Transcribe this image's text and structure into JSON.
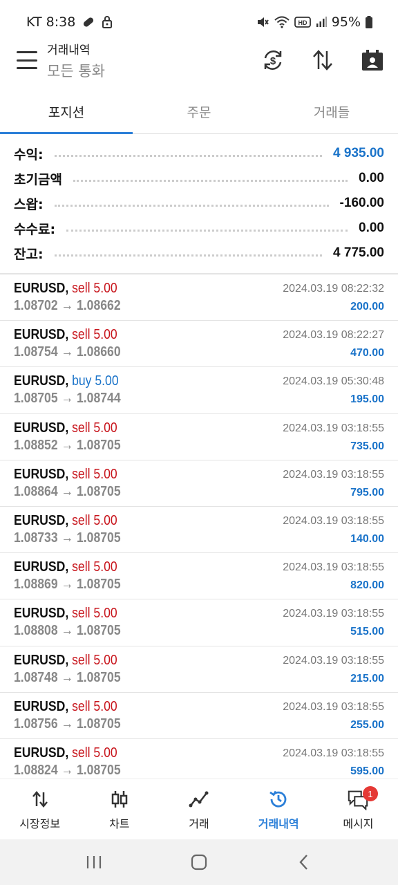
{
  "status_bar": {
    "carrier_time": "KT 8:38",
    "battery": "95%"
  },
  "header": {
    "title": "거래내역",
    "subtitle": "모든 통화"
  },
  "tabs": [
    {
      "label": "포지션",
      "active": true
    },
    {
      "label": "주문",
      "active": false
    },
    {
      "label": "거래들",
      "active": false
    }
  ],
  "summary": [
    {
      "label": "수익:",
      "value": "4 935.00"
    },
    {
      "label": "초기금액",
      "value": "0.00"
    },
    {
      "label": "스왑:",
      "value": "-160.00"
    },
    {
      "label": "수수료:",
      "value": "0.00"
    },
    {
      "label": "잔고:",
      "value": "4 775.00"
    }
  ],
  "deals": [
    {
      "symbol": "EURUSD,",
      "type": "sell 5.00",
      "side": "sell",
      "prices": "1.08702 → 1.08662",
      "time": "2024.03.19 08:22:32",
      "profit": "200.00"
    },
    {
      "symbol": "EURUSD,",
      "type": "sell 5.00",
      "side": "sell",
      "prices": "1.08754 → 1.08660",
      "time": "2024.03.19 08:22:27",
      "profit": "470.00"
    },
    {
      "symbol": "EURUSD,",
      "type": "buy 5.00",
      "side": "buy",
      "prices": "1.08705 → 1.08744",
      "time": "2024.03.19 05:30:48",
      "profit": "195.00"
    },
    {
      "symbol": "EURUSD,",
      "type": "sell 5.00",
      "side": "sell",
      "prices": "1.08852 → 1.08705",
      "time": "2024.03.19 03:18:55",
      "profit": "735.00"
    },
    {
      "symbol": "EURUSD,",
      "type": "sell 5.00",
      "side": "sell",
      "prices": "1.08864 → 1.08705",
      "time": "2024.03.19 03:18:55",
      "profit": "795.00"
    },
    {
      "symbol": "EURUSD,",
      "type": "sell 5.00",
      "side": "sell",
      "prices": "1.08733 → 1.08705",
      "time": "2024.03.19 03:18:55",
      "profit": "140.00"
    },
    {
      "symbol": "EURUSD,",
      "type": "sell 5.00",
      "side": "sell",
      "prices": "1.08869 → 1.08705",
      "time": "2024.03.19 03:18:55",
      "profit": "820.00"
    },
    {
      "symbol": "EURUSD,",
      "type": "sell 5.00",
      "side": "sell",
      "prices": "1.08808 → 1.08705",
      "time": "2024.03.19 03:18:55",
      "profit": "515.00"
    },
    {
      "symbol": "EURUSD,",
      "type": "sell 5.00",
      "side": "sell",
      "prices": "1.08748 → 1.08705",
      "time": "2024.03.19 03:18:55",
      "profit": "215.00"
    },
    {
      "symbol": "EURUSD,",
      "type": "sell 5.00",
      "side": "sell",
      "prices": "1.08756 → 1.08705",
      "time": "2024.03.19 03:18:55",
      "profit": "255.00"
    },
    {
      "symbol": "EURUSD,",
      "type": "sell 5.00",
      "side": "sell",
      "prices": "1.08824 → 1.08705",
      "time": "2024.03.19 03:18:55",
      "profit": "595.00"
    }
  ],
  "bottom_nav": [
    {
      "label": "시장정보",
      "icon": "quotes-arrows-icon",
      "active": false
    },
    {
      "label": "차트",
      "icon": "candlestick-icon",
      "active": false
    },
    {
      "label": "거래",
      "icon": "trend-line-icon",
      "active": false
    },
    {
      "label": "거래내역",
      "icon": "history-icon",
      "active": true
    },
    {
      "label": "메시지",
      "icon": "chat-icon",
      "active": false,
      "badge": "1"
    }
  ],
  "colors": {
    "accent": "#2b7fd8",
    "sell": "#c8161d",
    "buy": "#1a73c9",
    "profit": "#1a73c9"
  }
}
